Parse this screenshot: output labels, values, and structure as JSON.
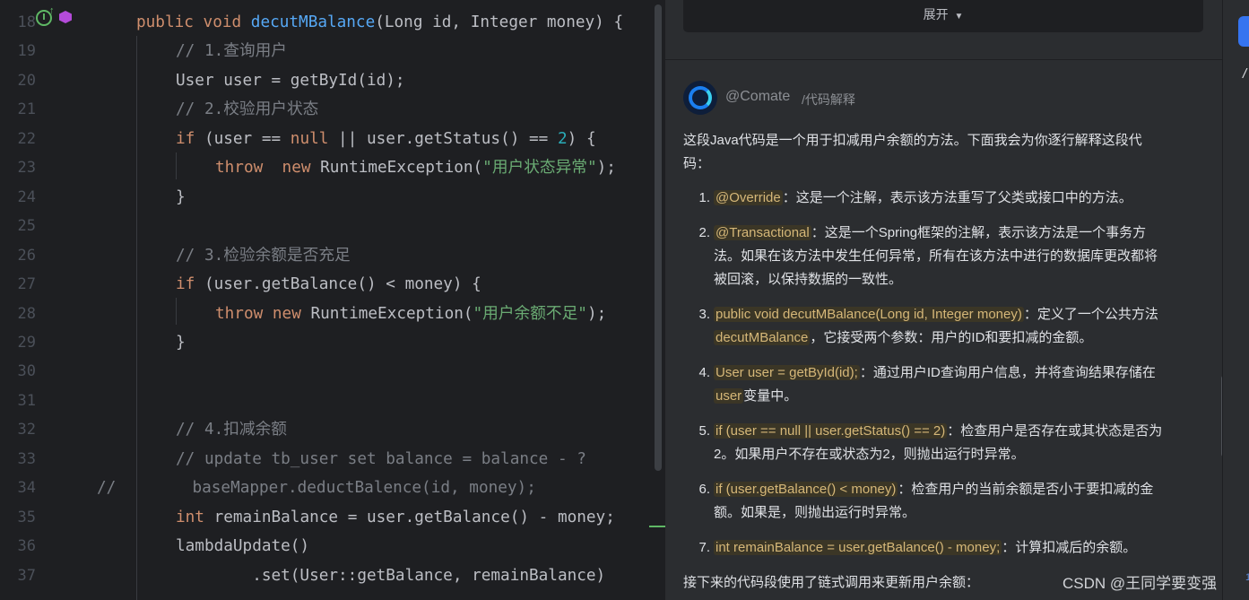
{
  "editor": {
    "line_numbers": [
      "18",
      "19",
      "20",
      "21",
      "22",
      "23",
      "24",
      "25",
      "26",
      "27",
      "28",
      "29",
      "30",
      "31",
      "32",
      "33",
      "34",
      "35",
      "36",
      "37"
    ],
    "lines": [
      [
        {
          "t": "public void ",
          "c": "kw"
        },
        {
          "t": "decutMBalance",
          "c": "fn"
        },
        {
          "t": "(Long id, Integer money) {",
          "c": ""
        }
      ],
      [
        {
          "t": "// 1.查询用户",
          "c": "cm"
        }
      ],
      [
        {
          "t": "User user = getById(id);",
          "c": ""
        }
      ],
      [
        {
          "t": "// 2.校验用户状态",
          "c": "cm"
        }
      ],
      [
        {
          "t": "if ",
          "c": "kw"
        },
        {
          "t": "(user == ",
          "c": ""
        },
        {
          "t": "null",
          "c": "kw"
        },
        {
          "t": " || user.getStatus() == ",
          "c": ""
        },
        {
          "t": "2",
          "c": "num"
        },
        {
          "t": ") {",
          "c": ""
        }
      ],
      [
        {
          "t": "throw  new ",
          "c": "kw"
        },
        {
          "t": "RuntimeException(",
          "c": ""
        },
        {
          "t": "\"用户状态异常\"",
          "c": "str"
        },
        {
          "t": ");",
          "c": ""
        }
      ],
      [
        {
          "t": "}",
          "c": ""
        }
      ],
      [],
      [
        {
          "t": "// 3.检验余额是否充足",
          "c": "cm"
        }
      ],
      [
        {
          "t": "if ",
          "c": "kw"
        },
        {
          "t": "(user.getBalance() < money) {",
          "c": ""
        }
      ],
      [
        {
          "t": "throw new ",
          "c": "kw"
        },
        {
          "t": "RuntimeException(",
          "c": ""
        },
        {
          "t": "\"用户余额不足\"",
          "c": "str"
        },
        {
          "t": ");",
          "c": ""
        }
      ],
      [
        {
          "t": "}",
          "c": ""
        }
      ],
      [],
      [],
      [
        {
          "t": "// 4.扣减余额",
          "c": "cm"
        }
      ],
      [
        {
          "t": "// update tb_user set balance = balance - ?",
          "c": "cm"
        }
      ],
      [
        {
          "t": "//        baseMapper.deductBalence(id, money);",
          "c": "cm"
        }
      ],
      [
        {
          "t": "int ",
          "c": "kw"
        },
        {
          "t": "remainBalance = user.getBalance() - money;",
          "c": ""
        }
      ],
      [
        {
          "t": "lambdaUpdate()",
          "c": ""
        }
      ],
      [
        {
          "t": "        .set(User::getBalance, remainBalance)",
          "c": ""
        }
      ]
    ]
  },
  "panel": {
    "expand_label": "展开",
    "expand_caret": "▼",
    "avatar_letter": "e",
    "comate_name": "@Comate",
    "comate_command": "/代码解释",
    "intro_line1": "这段Java代码是一个用于扣减用户余额的方法。下面我会为你逐行解释这段代",
    "intro_line2": "码：",
    "items": [
      {
        "num": "1.",
        "code": "@Override",
        "text": "：这是一个注解，表示该方法重写了父类或接口中的方法。",
        "line2": ""
      },
      {
        "num": "2.",
        "code": "@Transactional",
        "text": "：这是一个Spring框架的注解，表示该方法是一个事务方",
        "line2": "法。如果在该方法中发生任何异常，所有在该方法中进行的数据库更改都将",
        "line3": "被回滚，以保持数据的一致性。"
      },
      {
        "num": "3.",
        "code": "public void decutMBalance(Long id, Integer money)",
        "text": "：定义了一个公共方法",
        "code2": "decutMBalance",
        "line2": "，它接受两个参数：用户的ID和要扣减的金额。"
      },
      {
        "num": "4.",
        "code": "User user = getById(id);",
        "text": "：通过用户ID查询用户信息，并将查询结果存储在",
        "code2": "user",
        "line2": "变量中。"
      },
      {
        "num": "5.",
        "code": "if (user == null || user.getStatus() == 2)",
        "text": "：检查用户是否存在或其状态是否为",
        "line2": "2。如果用户不存在或状态为2，则抛出运行时异常。"
      },
      {
        "num": "6.",
        "code": "if (user.getBalance() < money)",
        "text": "：检查用户的当前余额是否小于要扣减的金",
        "line2": "额。如果是，则抛出运行时异常。"
      },
      {
        "num": "7.",
        "code": "int remainBalance = user.getBalance() - money;",
        "text": "：计算扣减后的余额。",
        "line2": ""
      }
    ],
    "outro": "接下来的代码段使用了链式调用来更新用户余额：",
    "watermark": "CSDN @王同学要变强"
  },
  "colors": {
    "editor_bg": "#1e1f22",
    "panel_bg": "#2b2d30",
    "keyword": "#cf8e6d",
    "function": "#56a8f5",
    "comment": "#7a7e85",
    "string": "#6aab73",
    "number": "#2aacb8",
    "inline_code_bg": "#3b3626",
    "inline_code_fg": "#d5b778"
  }
}
